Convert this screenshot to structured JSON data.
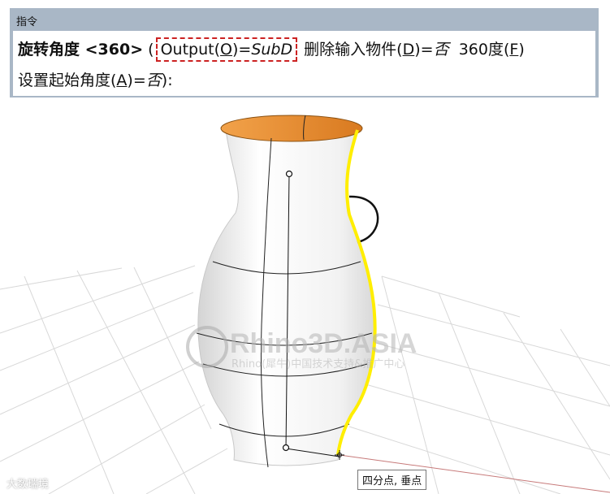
{
  "command_panel": {
    "title": "指令",
    "prompt_bold": "旋转角度 <360>",
    "open_paren": "(",
    "output_label": "Output(",
    "output_key": "O",
    "output_eq": ")=",
    "output_value": "SubD",
    "delete_label": "删除输入物件(",
    "delete_key": "D",
    "delete_eq": ")=",
    "delete_value": "否",
    "angle_label": "360度(",
    "angle_key": "F",
    "angle_close": ")",
    "start_label": "设置起始角度(",
    "start_key": "A",
    "start_eq": ")=",
    "start_value": "否",
    "start_close": "):"
  },
  "snap_tooltip": "四分点, 垂点",
  "watermark": {
    "title": "Rhino3D.ASIA",
    "subtitle": "Rhino(犀牛)中国技术支持&推广中心",
    "corner": "大数瑞境"
  },
  "colors": {
    "panel_bg": "#a9b7c6",
    "highlight_border": "#cc2222",
    "profile_curve": "#ffee00",
    "vase_interior": "#e9862a"
  }
}
